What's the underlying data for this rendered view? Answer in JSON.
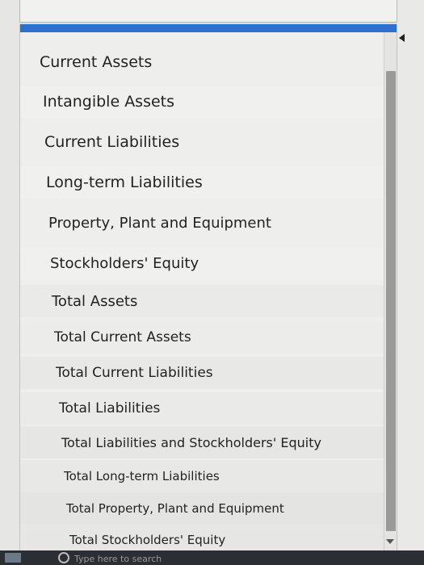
{
  "dropdown": {
    "options": [
      {
        "label": "Current Assets"
      },
      {
        "label": "Intangible Assets"
      },
      {
        "label": "Current Liabilities"
      },
      {
        "label": "Long-term Liabilities"
      },
      {
        "label": "Property, Plant and Equipment"
      },
      {
        "label": "Stockholders' Equity"
      },
      {
        "label": "Total Assets"
      },
      {
        "label": "Total Current Assets"
      },
      {
        "label": "Total Current Liabilities"
      },
      {
        "label": "Total Liabilities"
      },
      {
        "label": "Total Liabilities and Stockholders' Equity"
      },
      {
        "label": "Total Long-term Liabilities"
      },
      {
        "label": "Total Property, Plant and Equipment"
      },
      {
        "label": "Total Stockholders' Equity"
      }
    ]
  },
  "taskbar": {
    "search_text": "Type here to search"
  },
  "colors": {
    "accent": "#2f6fd0",
    "taskbar": "#2b2e33"
  }
}
